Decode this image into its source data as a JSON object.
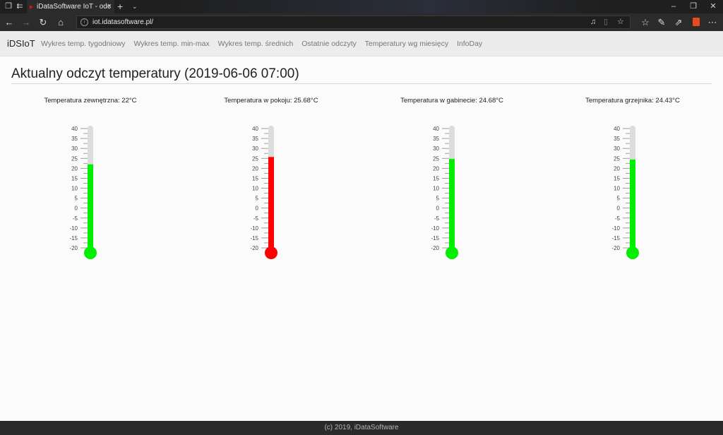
{
  "browser": {
    "tab_title": "iDataSoftware IoT - odc",
    "url": "iot.idatasoftware.pl/",
    "new_tab_symbol": "+",
    "tab_list_symbol": "⌄",
    "tab_close_symbol": "×"
  },
  "site": {
    "brand": "iDSIoT",
    "nav": [
      "Wykres temp. tygodniowy",
      "Wykres temp. min-max",
      "Wykres temp. średnich",
      "Ostatnie odczyty",
      "Temperatury wg miesięcy",
      "InfoDay"
    ]
  },
  "main": {
    "title": "Aktualny odczyt temperatury (2019-06-06 07:00)"
  },
  "scale": {
    "min": -20,
    "max": 40,
    "ticks": [
      "40",
      "35",
      "30",
      "25",
      "20",
      "15",
      "10",
      "5",
      "0",
      "-5",
      "-10",
      "-15",
      "-20"
    ]
  },
  "gauges": [
    {
      "label": "Temperatura zewnętrzna: 22°C",
      "value": 22,
      "color": "#00ee00"
    },
    {
      "label": "Temperatura w pokoju: 25.68°C",
      "value": 25.68,
      "color": "#ff0000"
    },
    {
      "label": "Temperatura w gabinecie: 24.68°C",
      "value": 24.68,
      "color": "#00ee00"
    },
    {
      "label": "Temperatura grzejnika: 24.43°C",
      "value": 24.43,
      "color": "#00ee00"
    }
  ],
  "footer": {
    "text": "(c) 2019, iDataSoftware"
  },
  "colors": {
    "tube_background": "#dcdcdc",
    "tick_color": "#888888",
    "footer_background": "#2a2a2a"
  }
}
